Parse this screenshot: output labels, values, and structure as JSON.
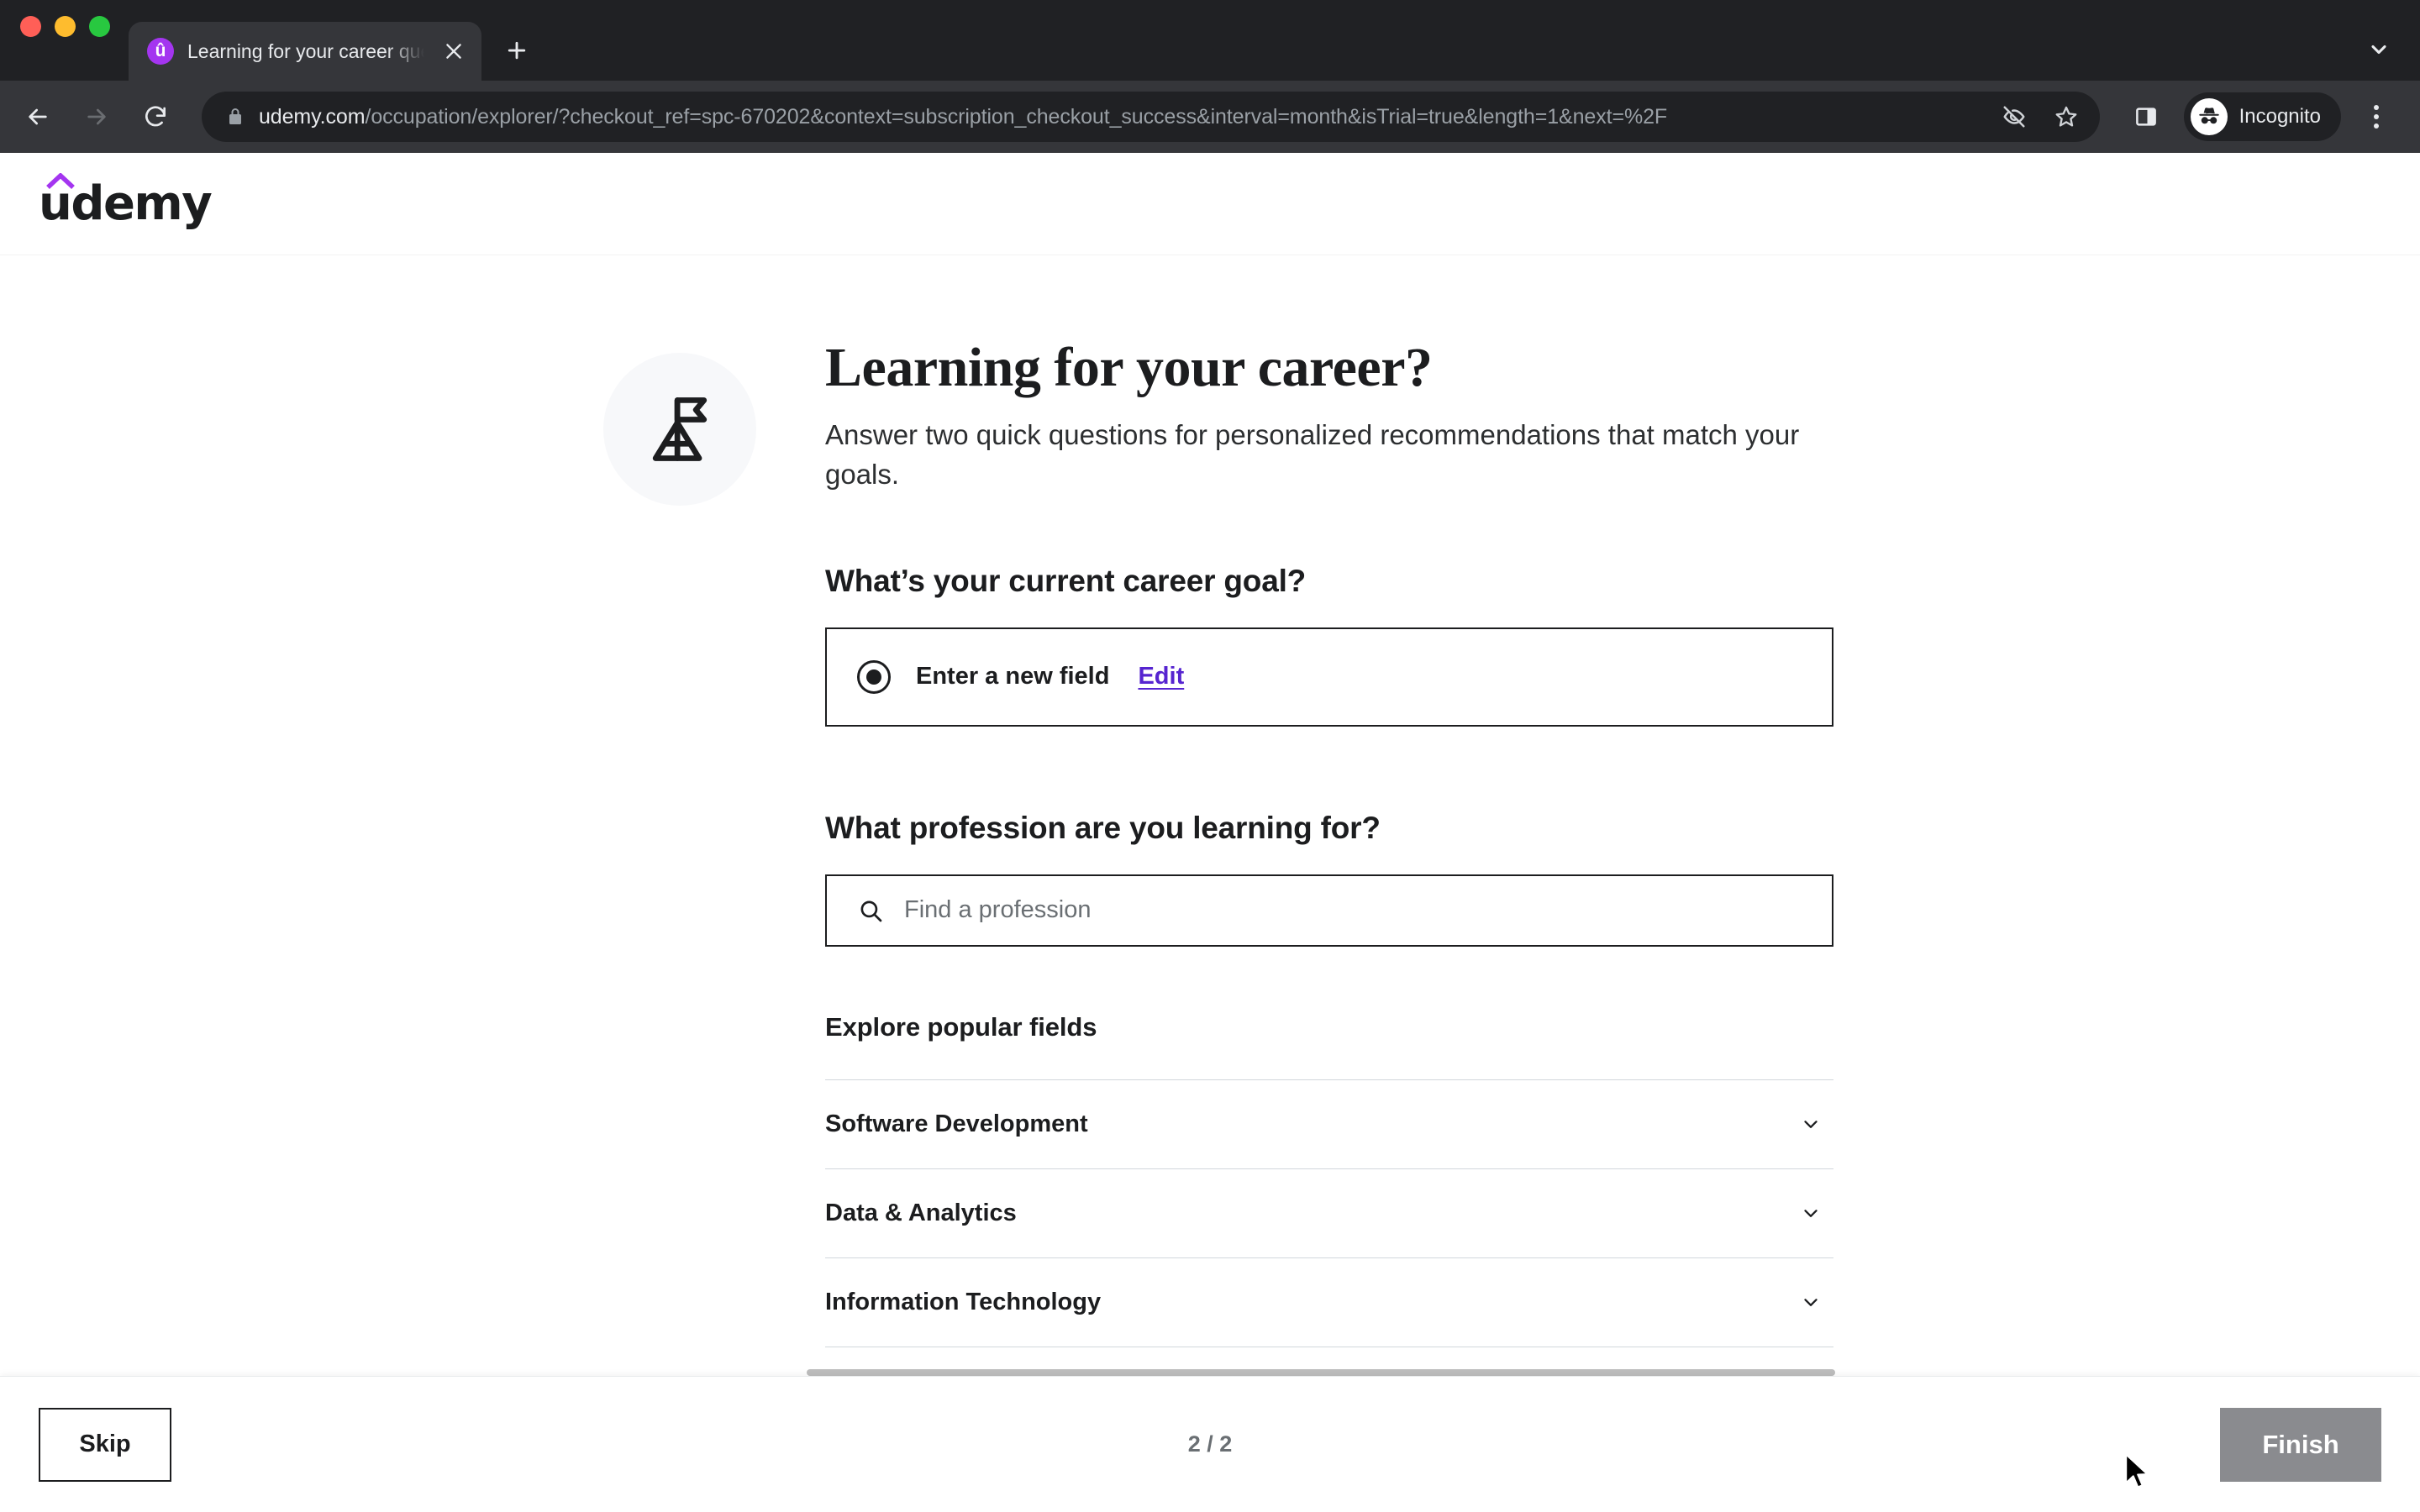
{
  "browser": {
    "tab": {
      "title": "Learning for your career questi",
      "favicon_icon": "udemy-favicon",
      "close_icon": "close-icon"
    },
    "new_tab_icon": "plus-icon",
    "tab_search_icon": "chevron-down-icon",
    "nav": {
      "back_icon": "arrow-left-icon",
      "forward_icon": "arrow-right-icon",
      "reload_icon": "reload-icon"
    },
    "omnibox": {
      "lock_icon": "lock-icon",
      "url_host": "udemy.com",
      "url_path": "/occupation/explorer/?checkout_ref=spc-670202&context=subscription_checkout_success&interval=month&isTrial=true&length=1&next=%2F",
      "tracking_icon": "eye-crossed-icon",
      "bookmark_icon": "star-icon"
    },
    "sidepanel_icon": "side-panel-icon",
    "profile": {
      "label": "Incognito",
      "avatar_icon": "incognito-hat-icon"
    },
    "menu_icon": "kebab-menu-icon"
  },
  "site": {
    "logo_text": "udemy",
    "logo_accent_color": "#a435f0"
  },
  "hero": {
    "badge_icon": "goal-flag-icon",
    "title": "Learning for your career?",
    "subtitle": "Answer two quick questions for personalized recommendations that match your goals."
  },
  "career_goal": {
    "question": "What’s your current career goal?",
    "option": {
      "radio_icon": "radio-selected-icon",
      "label": "Enter a new field",
      "edit_label": "Edit",
      "selected": true
    }
  },
  "profession": {
    "question": "What profession are you learning for?",
    "search": {
      "icon": "search-icon",
      "placeholder": "Find a profession",
      "value": ""
    },
    "explore_title": "Explore popular fields",
    "fields": [
      {
        "label": "Software Development",
        "chevron_icon": "chevron-down-icon",
        "expanded": false
      },
      {
        "label": "Data & Analytics",
        "chevron_icon": "chevron-down-icon",
        "expanded": false
      },
      {
        "label": "Information Technology",
        "chevron_icon": "chevron-down-icon",
        "expanded": false
      }
    ]
  },
  "footer": {
    "skip_label": "Skip",
    "counter": "2 / 2",
    "finish_label": "Finish",
    "finish_disabled": true,
    "finish_color": "#8a8b8f"
  },
  "cursor": {
    "icon": "mouse-pointer-icon"
  }
}
